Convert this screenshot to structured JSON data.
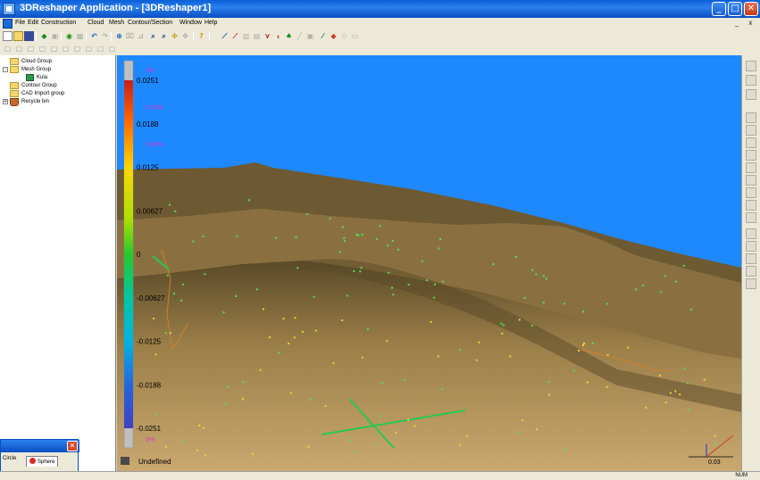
{
  "window": {
    "title": "3DReshaper Application - [3DReshaper1]",
    "controls": {
      "minimize": "_",
      "maximize": "□",
      "close": "✕"
    }
  },
  "menu": {
    "items": [
      "File",
      "Edit",
      "Construction",
      "Cloud",
      "Mesh",
      "Contour/Section",
      "Window",
      "Help"
    ],
    "mdi_controls": {
      "minimize": "_",
      "restore": "▫",
      "close": "x"
    }
  },
  "toolbar": {
    "row1_icons": [
      "new-file-icon",
      "open-folder-icon",
      "save-icon",
      "import-icon",
      "export-icon",
      "cloud-icon",
      "mesh-icon",
      "undo-icon",
      "redo-icon",
      "zoom-icon",
      "zoom-window-icon",
      "rotate-icon",
      "pan-icon",
      "help-icon",
      "draw-icon",
      "measure-icon",
      "cut-icon",
      "section-icon",
      "contour-icon",
      "color-icon",
      "pen-icon",
      "text-icon",
      "render-icon",
      "light-icon"
    ],
    "row2_icons": [
      "view-front-icon",
      "view-back-icon",
      "view-left-icon",
      "view-right-icon",
      "view-top-icon",
      "view-iso-icon"
    ]
  },
  "tree": {
    "items": [
      {
        "label": "Cloud Group",
        "level": 0,
        "expander": "",
        "icon": "folder-icon"
      },
      {
        "label": "Mesh Group",
        "level": 0,
        "expander": "-",
        "icon": "folder-icon"
      },
      {
        "label": "Kula",
        "level": 1,
        "expander": "",
        "icon": "mesh-object-icon"
      },
      {
        "label": "Contour Group",
        "level": 0,
        "expander": "",
        "icon": "folder-icon"
      },
      {
        "label": "CAD Import group",
        "level": 0,
        "expander": "",
        "icon": "folder-icon"
      },
      {
        "label": "Recycle bin",
        "level": 0,
        "expander": "+",
        "icon": "recycle-bin-icon"
      }
    ]
  },
  "floating_panel": {
    "tab_left": "Circle",
    "tab_active": "Sphere",
    "close": "✕"
  },
  "color_scale": {
    "values": [
      "0.0251",
      "0.0188",
      "0.0125",
      "0.00627",
      "0",
      "-0.00627",
      "-0.0125",
      "-0.0188",
      "-0.0251"
    ],
    "percentages": [
      "0%",
      "0.43%",
      "0.86%",
      "",
      "",
      "",
      "",
      "",
      "",
      "",
      "0%"
    ],
    "undefined_label": "Undefined",
    "colors": [
      "#c81e1e",
      "#ff7a00",
      "#ffd400",
      "#a8e000",
      "#28c828",
      "#00c8a0",
      "#00b4e6",
      "#2864dc",
      "#4040c0"
    ]
  },
  "scene": {
    "sky_color": "#1e88ff",
    "terrain_color": "#7a6336",
    "terrain_light": "#c9a870",
    "point_colors": [
      "#55e055",
      "#f0d040"
    ],
    "scale_bar_label": "0.03"
  },
  "status": {
    "num": "NUM"
  }
}
